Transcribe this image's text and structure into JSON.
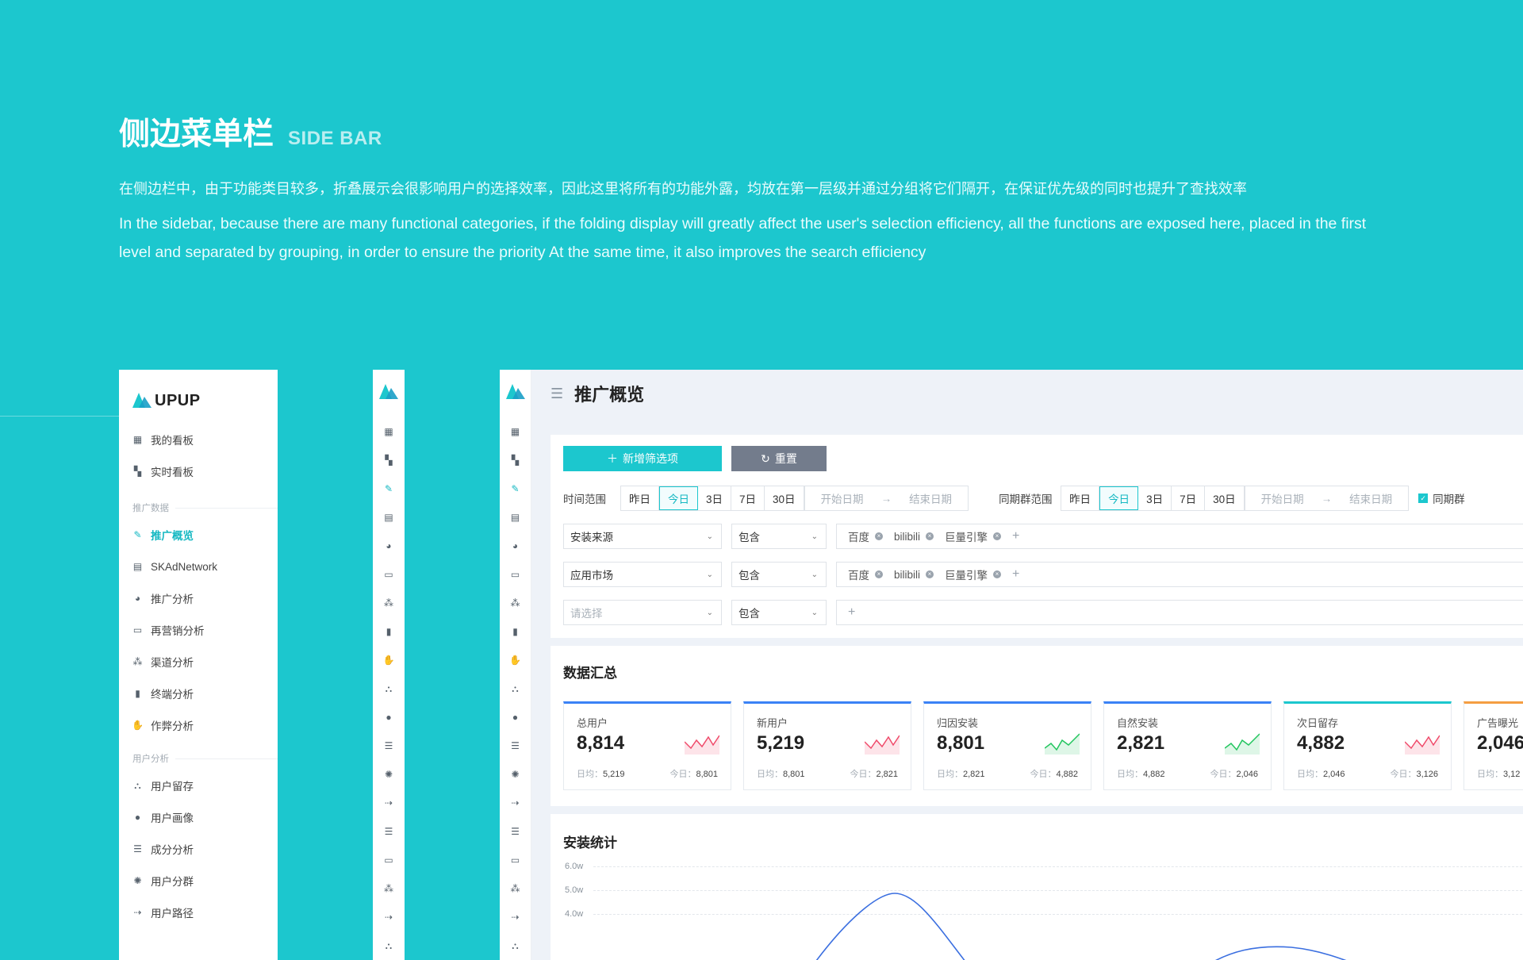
{
  "intro": {
    "title": "侧边菜单栏",
    "subtitle": "SIDE BAR",
    "desc_cn": "在侧边栏中，由于功能类目较多，折叠展示会很影响用户的选择效率，因此这里将所有的功能外露，均放在第一层级并通过分组将它们隔开，在保证优先级的同时也提升了查找效率",
    "desc_en": "In the sidebar, because there are many functional categories, if the folding display will greatly affect the user's selection efficiency, all the functions are exposed here, placed in the first level and separated by grouping, in order to ensure the priority At the same time, it also improves the search efficiency"
  },
  "brand": {
    "name": "UPUP",
    "accent": "#1cc7ce",
    "logo_dark": "#1a9fc7"
  },
  "sidebar": {
    "top_items": [
      {
        "label": "我的看板",
        "icon": "dashboard-icon"
      },
      {
        "label": "实时看板",
        "icon": "grid-icon"
      }
    ],
    "group1": "推广数据",
    "group1_items": [
      {
        "label": "推广概览",
        "icon": "edit-icon",
        "active": true
      },
      {
        "label": "SKAdNetwork",
        "icon": "document-icon"
      },
      {
        "label": "推广分析",
        "icon": "pie-icon"
      },
      {
        "label": "再营销分析",
        "icon": "card-icon"
      },
      {
        "label": "渠道分析",
        "icon": "share-icon"
      },
      {
        "label": "终端分析",
        "icon": "device-icon"
      },
      {
        "label": "作弊分析",
        "icon": "hand-icon"
      }
    ],
    "group2": "用户分析",
    "group2_items": [
      {
        "label": "用户留存",
        "icon": "hierarchy-icon"
      },
      {
        "label": "用户画像",
        "icon": "user-icon"
      },
      {
        "label": "成分分析",
        "icon": "user-list-icon"
      },
      {
        "label": "用户分群",
        "icon": "group-icon"
      },
      {
        "label": "用户路径",
        "icon": "path-icon"
      }
    ]
  },
  "header": {
    "title": "推广概览"
  },
  "filters": {
    "add_label": "新增筛选项",
    "reset_label": "重置",
    "time_label": "时间范围",
    "cohort_label": "同期群范围",
    "periods": [
      "昨日",
      "今日",
      "3日",
      "7日",
      "30日"
    ],
    "active_period": "今日",
    "start_placeholder": "开始日期",
    "end_placeholder": "结束日期",
    "cohort_check": "同期群",
    "rows": [
      {
        "field": "安装来源",
        "op": "包含",
        "tags": [
          "百度",
          "bilibili",
          "巨量引擎"
        ]
      },
      {
        "field": "应用市场",
        "op": "包含",
        "tags": [
          "百度",
          "bilibili",
          "巨量引擎"
        ]
      },
      {
        "field": "请选择",
        "op": "包含",
        "tags": []
      }
    ]
  },
  "summary": {
    "title": "数据汇总",
    "daily_label": "日均：",
    "today_label": "今日：",
    "cards": [
      {
        "title": "总用户",
        "value": "8,814",
        "avg": "5,219",
        "today": "8,801",
        "trend": "down",
        "color": "#3b82f6"
      },
      {
        "title": "新用户",
        "value": "5,219",
        "avg": "8,801",
        "today": "2,821",
        "trend": "down",
        "color": "#3b82f6"
      },
      {
        "title": "归因安装",
        "value": "8,801",
        "avg": "2,821",
        "today": "4,882",
        "trend": "up",
        "color": "#3b82f6"
      },
      {
        "title": "自然安装",
        "value": "2,821",
        "avg": "4,882",
        "today": "2,046",
        "trend": "up",
        "color": "#3b82f6"
      },
      {
        "title": "次日留存",
        "value": "4,882",
        "avg": "2,046",
        "today": "3,126",
        "trend": "down",
        "color": "#1cc7ce"
      },
      {
        "title": "广告曝光",
        "value": "2,046",
        "avg": "3,12",
        "today": "",
        "trend": "down",
        "color": "#f59e42"
      }
    ]
  },
  "install": {
    "title": "安装统计",
    "yticks": [
      "6.0w",
      "5.0w",
      "4.0w"
    ]
  }
}
